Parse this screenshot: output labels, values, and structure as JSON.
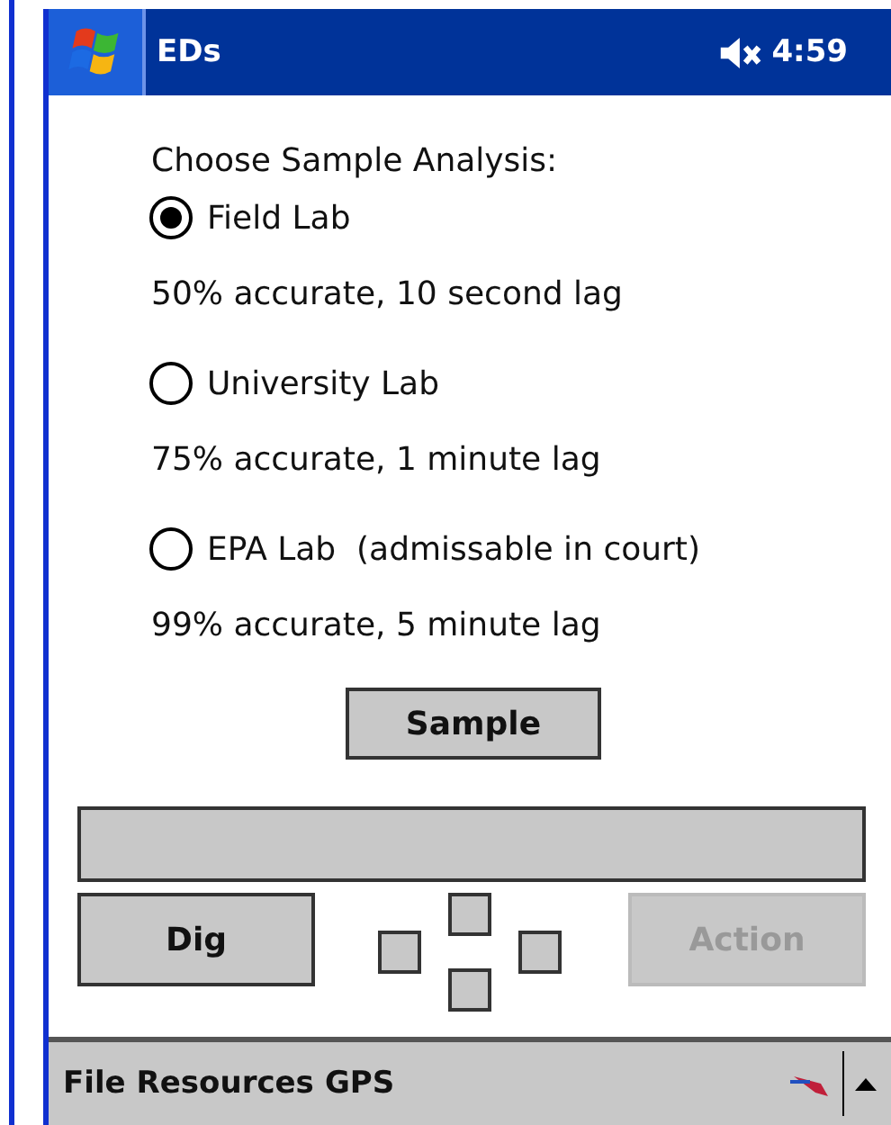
{
  "window": {
    "title": "EDs",
    "muted": true,
    "time": "4:59"
  },
  "prompt": "Choose Sample Analysis:",
  "options": [
    {
      "label": "Field Lab",
      "note": "50% accurate, 10 second lag",
      "selected": true
    },
    {
      "label": "University Lab",
      "note": "75% accurate, 1 minute lag",
      "selected": false
    },
    {
      "label": "EPA Lab  (admissable in court)",
      "note": "99% accurate, 5 minute lag",
      "selected": false
    }
  ],
  "sample_button": {
    "label": "Sample",
    "disabled": false
  },
  "dig_button": {
    "label": "Dig",
    "disabled": false
  },
  "action_button": {
    "label": "Action",
    "disabled": true
  },
  "menu": [
    "File",
    "Resources",
    "GPS"
  ]
}
